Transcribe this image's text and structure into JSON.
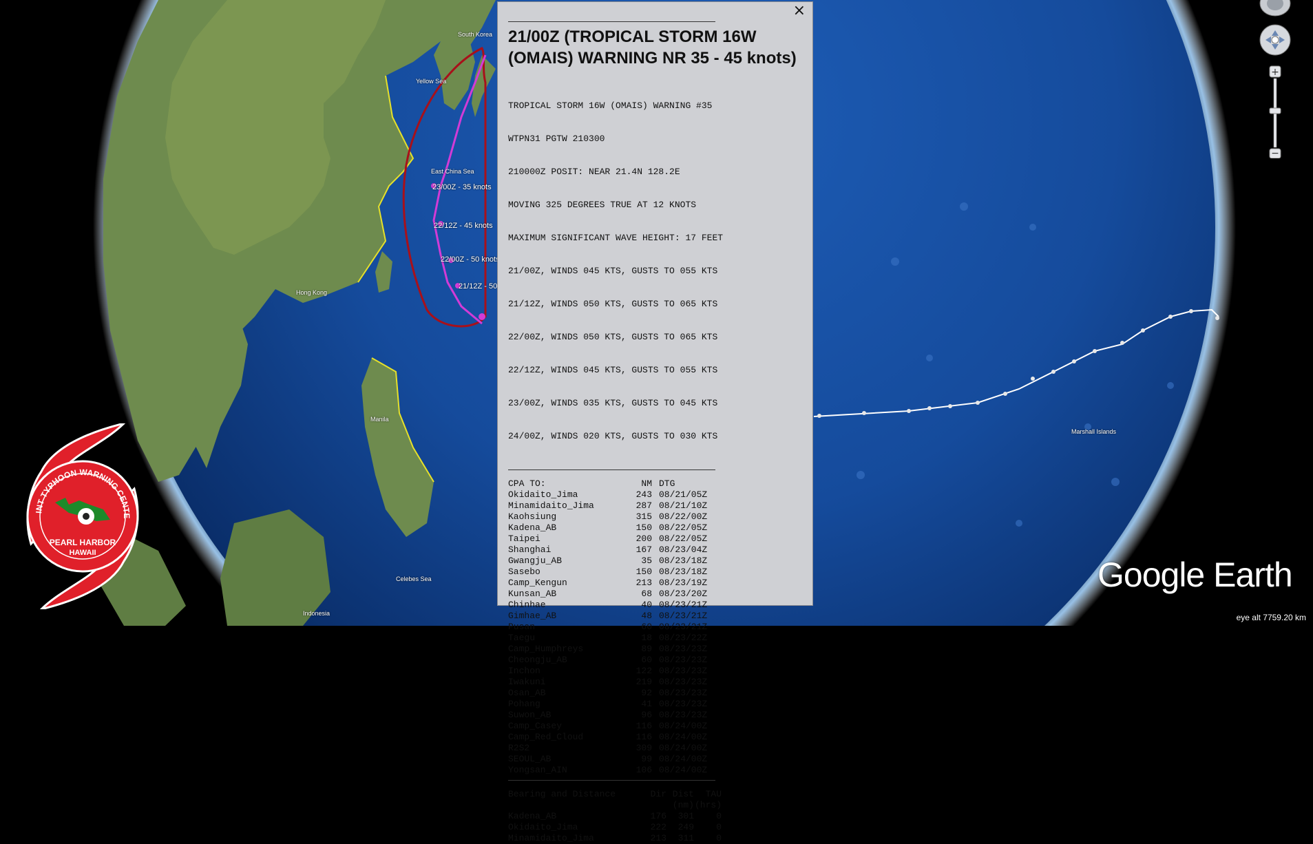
{
  "colors": {
    "ocean": "#0d3f8c",
    "land": "#6a8a4a",
    "popup_bg": "#cfd0d4",
    "track_red": "#a8101a",
    "track_magenta": "#d23bd6",
    "coast_yellow": "#e6e02a",
    "jtwc_red": "#e0202a"
  },
  "popup": {
    "close_icon": "×",
    "title": "21/00Z (TROPICAL STORM 16W (OMAIS) WARNING NR 35 - 45 knots)",
    "warning_lines": [
      "TROPICAL STORM 16W (OMAIS) WARNING #35",
      "WTPN31 PGTW 210300",
      "210000Z POSIT: NEAR 21.4N 128.2E",
      "MOVING 325 DEGREES TRUE AT 12 KNOTS",
      "MAXIMUM SIGNIFICANT WAVE HEIGHT: 17 FEET",
      "21/00Z, WINDS 045 KTS, GUSTS TO 055 KTS",
      "21/12Z, WINDS 050 KTS, GUSTS TO 065 KTS",
      "22/00Z, WINDS 050 KTS, GUSTS TO 065 KTS",
      "22/12Z, WINDS 045 KTS, GUSTS TO 055 KTS",
      "23/00Z, WINDS 035 KTS, GUSTS TO 045 KTS",
      "24/00Z, WINDS 020 KTS, GUSTS TO 030 KTS"
    ],
    "cpa_header": {
      "label": "CPA TO:",
      "nm": "NM",
      "dtg": "DTG"
    },
    "cpa_rows": [
      {
        "name": "Okidaito_Jima",
        "nm": "243",
        "dtg": "08/21/05Z"
      },
      {
        "name": "Minamidaito_Jima",
        "nm": "287",
        "dtg": "08/21/10Z"
      },
      {
        "name": "Kaohsiung",
        "nm": "315",
        "dtg": "08/22/00Z"
      },
      {
        "name": "Kadena_AB",
        "nm": "150",
        "dtg": "08/22/05Z"
      },
      {
        "name": "Taipei",
        "nm": "200",
        "dtg": "08/22/05Z"
      },
      {
        "name": "Shanghai",
        "nm": "167",
        "dtg": "08/23/04Z"
      },
      {
        "name": "Gwangju_AB",
        "nm": "35",
        "dtg": "08/23/18Z"
      },
      {
        "name": "Sasebo",
        "nm": "150",
        "dtg": "08/23/18Z"
      },
      {
        "name": "Camp_Kengun",
        "nm": "213",
        "dtg": "08/23/19Z"
      },
      {
        "name": "Kunsan_AB",
        "nm": "68",
        "dtg": "08/23/20Z"
      },
      {
        "name": "Chinhae",
        "nm": "40",
        "dtg": "08/23/21Z"
      },
      {
        "name": "Gimhae_AB",
        "nm": "48",
        "dtg": "08/23/21Z"
      },
      {
        "name": "Pusan",
        "nm": "60",
        "dtg": "08/23/21Z"
      },
      {
        "name": "Taegu",
        "nm": "18",
        "dtg": "08/23/22Z"
      },
      {
        "name": "Camp_Humphreys",
        "nm": "89",
        "dtg": "08/23/23Z"
      },
      {
        "name": "Cheongju_AB",
        "nm": "60",
        "dtg": "08/23/23Z"
      },
      {
        "name": "Inchon",
        "nm": "122",
        "dtg": "08/23/23Z"
      },
      {
        "name": "Iwakuni",
        "nm": "219",
        "dtg": "08/23/23Z"
      },
      {
        "name": "Osan_AB",
        "nm": "92",
        "dtg": "08/23/23Z"
      },
      {
        "name": "Pohang",
        "nm": "41",
        "dtg": "08/23/23Z"
      },
      {
        "name": "Suwon_AB",
        "nm": "96",
        "dtg": "08/23/23Z"
      },
      {
        "name": "Camp_Casey",
        "nm": "116",
        "dtg": "08/24/00Z"
      },
      {
        "name": "Camp_Red_Cloud",
        "nm": "116",
        "dtg": "08/24/00Z"
      },
      {
        "name": "R2S2",
        "nm": "309",
        "dtg": "08/24/00Z"
      },
      {
        "name": "SEOUL_AB",
        "nm": "99",
        "dtg": "08/24/00Z"
      },
      {
        "name": "Yongsan_AIN",
        "nm": "106",
        "dtg": "08/24/00Z"
      }
    ],
    "bd_header": {
      "label": "Bearing and Distance",
      "dir": "Dir",
      "dist": "Dist",
      "tau": "TAU",
      "dist_unit": "(nm)",
      "tau_unit": "(hrs)"
    },
    "bd_rows": [
      {
        "name": "Kadena_AB",
        "dir": "176",
        "dist": "301",
        "tau": "0"
      },
      {
        "name": "Okidaito_Jima",
        "dir": "222",
        "dist": "249",
        "tau": "0"
      },
      {
        "name": "Minamidaito_Jima",
        "dir": "213",
        "dist": "311",
        "tau": "0"
      }
    ]
  },
  "map": {
    "storm_labels": [
      "23/00Z - 35 knots",
      "22/12Z - 45 knots",
      "22/00Z - 50 knots",
      "21/12Z - 50"
    ],
    "place_labels": [
      "South Korea",
      "Yellow Sea",
      "East China Sea",
      "Hong Kong",
      "Marshall Islands",
      "Manila",
      "Celebes Sea",
      "Indonesia"
    ]
  },
  "logo": {
    "ring_top": "JOINT TYPHOON WARNING CENTER",
    "line1": "PEARL HARBOR",
    "line2": "HAWAII"
  },
  "branding": {
    "google_earth": "Google Earth"
  },
  "status": {
    "eye_alt": "eye alt 7759.20 km"
  },
  "nav_icons": [
    "compass-icon",
    "look-joystick-icon",
    "zoom-in-icon",
    "zoom-slider",
    "zoom-out-icon"
  ]
}
